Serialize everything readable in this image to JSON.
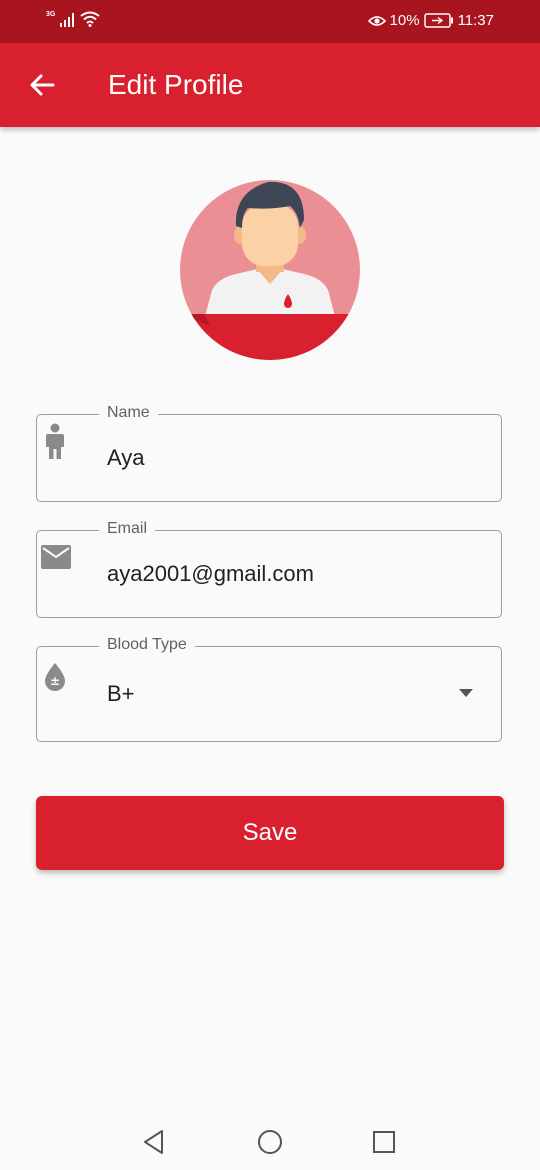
{
  "status_bar": {
    "network": "3G",
    "battery": "10%",
    "time": "11:37"
  },
  "app_bar": {
    "title": "Edit Profile"
  },
  "form": {
    "name": {
      "label": "Name",
      "value": "Aya",
      "icon": "person-icon"
    },
    "email": {
      "label": "Email",
      "value": "aya2001@gmail.com",
      "icon": "mail-icon"
    },
    "blood_type": {
      "label": "Blood Type",
      "value": "B+",
      "icon": "blood-drop-icon"
    }
  },
  "save_label": "Save",
  "colors": {
    "primary": "#d9202e",
    "status_bar": "#a8151f",
    "background": "#fafafa"
  }
}
